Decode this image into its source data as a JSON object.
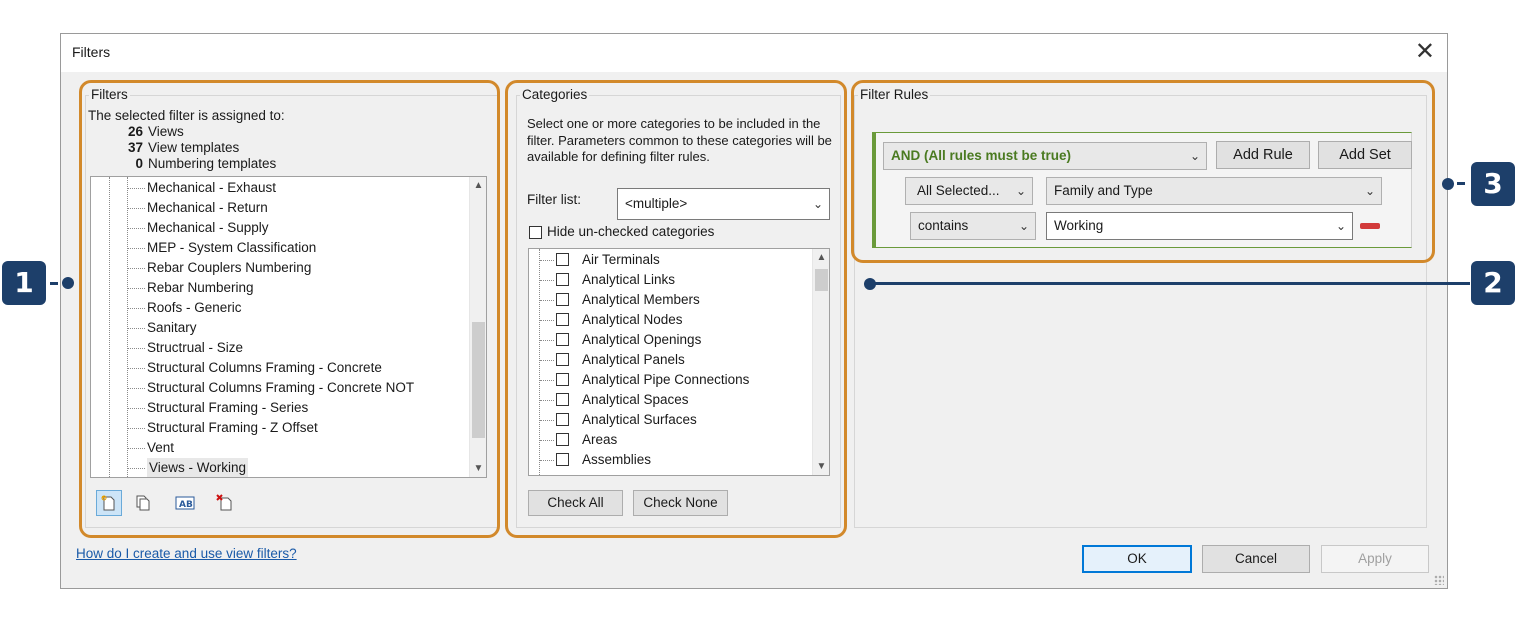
{
  "window": {
    "title": "Filters",
    "close_glyph": "✕"
  },
  "filters_panel": {
    "legend": "Filters",
    "assigned_heading": "The selected filter is assigned to:",
    "counts": [
      {
        "num": "26",
        "label": "Views"
      },
      {
        "num": "37",
        "label": "View templates"
      },
      {
        "num": "0",
        "label": "Numbering templates"
      }
    ],
    "items": [
      "Mechanical - Exhaust",
      "Mechanical - Return",
      "Mechanical - Supply",
      "MEP - System Classification",
      "Rebar Couplers Numbering",
      "Rebar Numbering",
      "Roofs - Generic",
      "Sanitary",
      "Structrual - Size",
      "Structural Columns Framing - Concrete",
      "Structural Columns Framing - Concrete NOT",
      "Structural Framing - Series",
      "Structural Framing - Z Offset",
      "Vent",
      "Views - Working"
    ],
    "selected_item": "Views - Working",
    "toolbar_icons": [
      "new-filter-icon",
      "duplicate-filter-icon",
      "rename-filter-icon",
      "delete-filter-icon"
    ]
  },
  "categories_panel": {
    "legend": "Categories",
    "description": "Select one or more categories to be included in the filter.  Parameters common to these categories will be available for defining filter rules.",
    "filter_list_label": "Filter list:",
    "filter_list_value": "<multiple>",
    "hide_unchecked_label": "Hide un-checked categories",
    "items": [
      "Air Terminals",
      "Analytical Links",
      "Analytical Members",
      "Analytical Nodes",
      "Analytical Openings",
      "Analytical Panels",
      "Analytical Pipe Connections",
      "Analytical Spaces",
      "Analytical Surfaces",
      "Areas",
      "Assemblies"
    ],
    "check_all_label": "Check All",
    "check_none_label": "Check None"
  },
  "rules_panel": {
    "legend": "Filter Rules",
    "logic_value": "AND (All rules must be true)",
    "add_rule_label": "Add Rule",
    "add_set_label": "Add Set",
    "category_value": "All Selected...",
    "parameter_value": "Family and Type",
    "operator_value": "contains",
    "rule_value": "Working"
  },
  "footer": {
    "help_link": "How do I create and use view filters?",
    "ok_label": "OK",
    "cancel_label": "Cancel",
    "apply_label": "Apply"
  },
  "callouts": {
    "one": "1",
    "two": "2",
    "three": "3"
  },
  "colors": {
    "callout": "#1d3f6a",
    "highlight_frame": "#d2892b",
    "rule_set_green": "#4a7a20",
    "link": "#1a5aa8"
  }
}
